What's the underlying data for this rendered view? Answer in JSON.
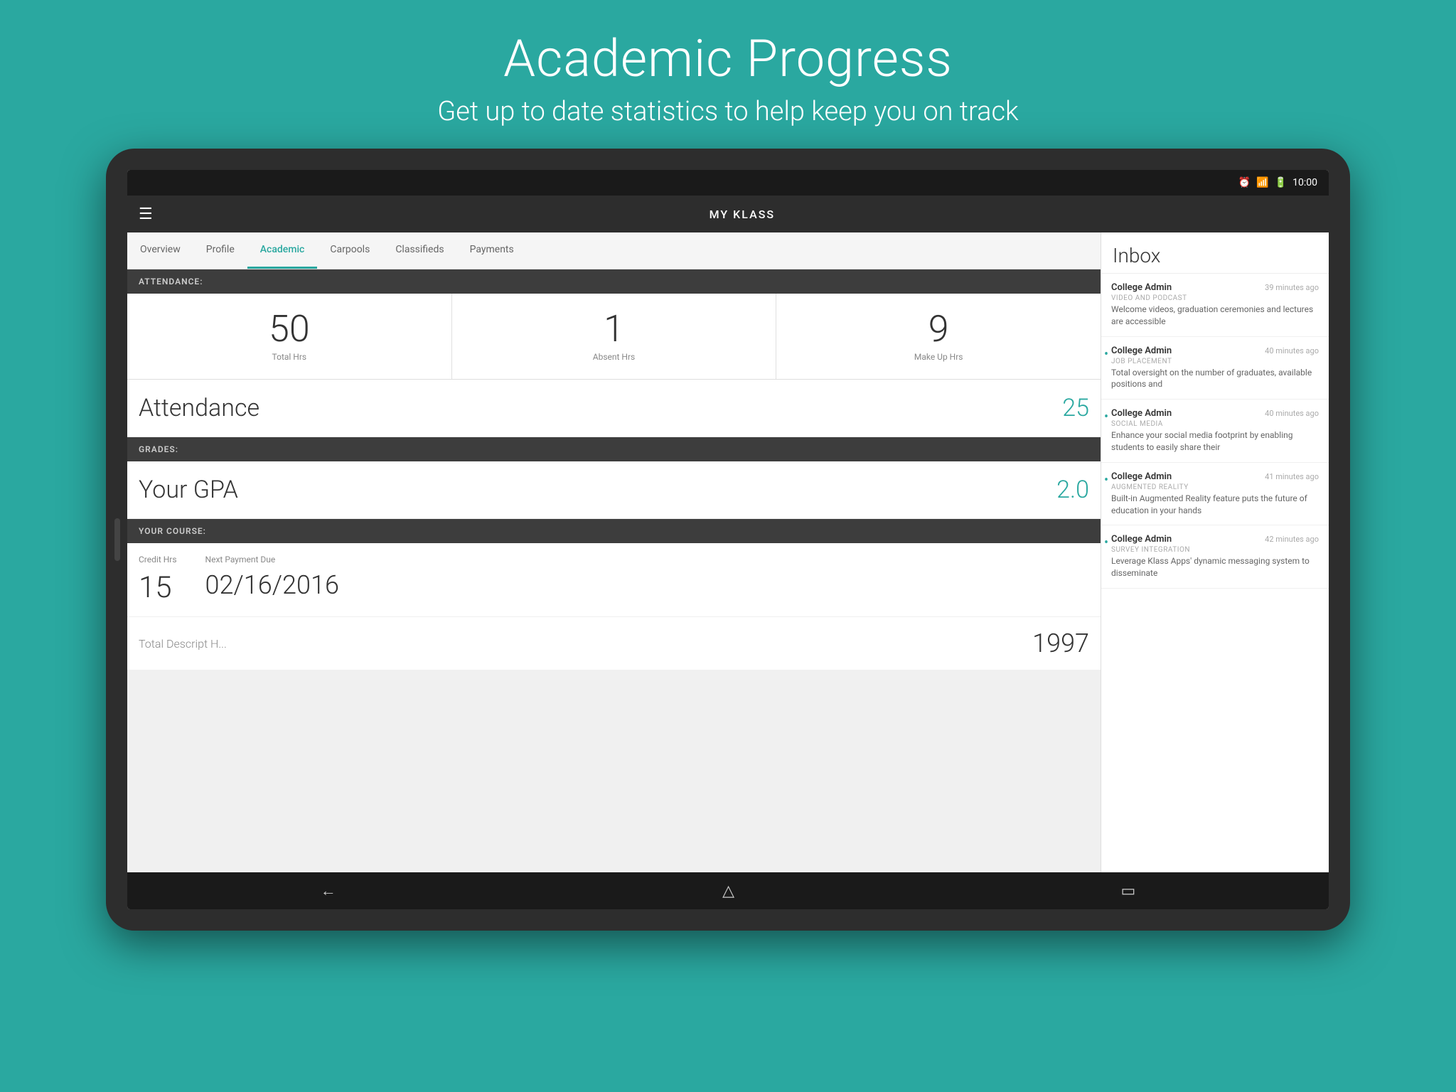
{
  "page": {
    "title": "Academic Progress",
    "subtitle": "Get up to date statistics to help keep you on track"
  },
  "statusBar": {
    "time": "10:00",
    "icons": [
      "⏰",
      "📶",
      "🔋"
    ]
  },
  "appBar": {
    "title": "MY KLASS",
    "menuIcon": "☰"
  },
  "tabs": [
    {
      "label": "Overview",
      "active": false
    },
    {
      "label": "Profile",
      "active": false
    },
    {
      "label": "Academic",
      "active": true
    },
    {
      "label": "Carpools",
      "active": false
    },
    {
      "label": "Classifieds",
      "active": false
    },
    {
      "label": "Payments",
      "active": false
    }
  ],
  "attendance": {
    "sectionLabel": "ATTENDANCE:",
    "stats": [
      {
        "value": "50",
        "label": "Total Hrs"
      },
      {
        "value": "1",
        "label": "Absent Hrs"
      },
      {
        "value": "9",
        "label": "Make Up Hrs"
      }
    ],
    "rowLabel": "Attendance",
    "rowValue": "25"
  },
  "grades": {
    "sectionLabel": "GRADES:",
    "rowLabel": "Your GPA",
    "rowValue": "2.0"
  },
  "course": {
    "sectionLabel": "YOUR COURSE:",
    "creditHrsLabel": "Credit Hrs",
    "creditHrsValue": "15",
    "nextPaymentLabel": "Next Payment Due",
    "nextPaymentValue": "02/16/2016"
  },
  "partialRow": {
    "label": "Total Descript H...",
    "value": "1997"
  },
  "inbox": {
    "title": "Inbox",
    "items": [
      {
        "sender": "College Admin",
        "time": "39 minutes ago",
        "category": "VIDEO AND PODCAST",
        "preview": "Welcome videos, graduation ceremonies and lectures are accessible",
        "unread": false
      },
      {
        "sender": "College Admin",
        "time": "40 minutes ago",
        "category": "JOB PLACEMENT",
        "preview": "Total oversight on the number of graduates, available positions and",
        "unread": true
      },
      {
        "sender": "College Admin",
        "time": "40 minutes ago",
        "category": "SOCIAL MEDIA",
        "preview": "Enhance your social media footprint by enabling students to easily share their",
        "unread": true
      },
      {
        "sender": "College Admin",
        "time": "41 minutes ago",
        "category": "AUGMENTED REALITY",
        "preview": "Built-in Augmented Reality feature puts the future of education in your hands",
        "unread": true
      },
      {
        "sender": "College Admin",
        "time": "42 minutes ago",
        "category": "SURVEY INTEGRATION",
        "preview": "Leverage Klass Apps' dynamic messaging system to disseminate",
        "unread": true
      }
    ]
  },
  "navBar": {
    "backIcon": "←",
    "homeIcon": "△",
    "recentsIcon": "▭"
  }
}
